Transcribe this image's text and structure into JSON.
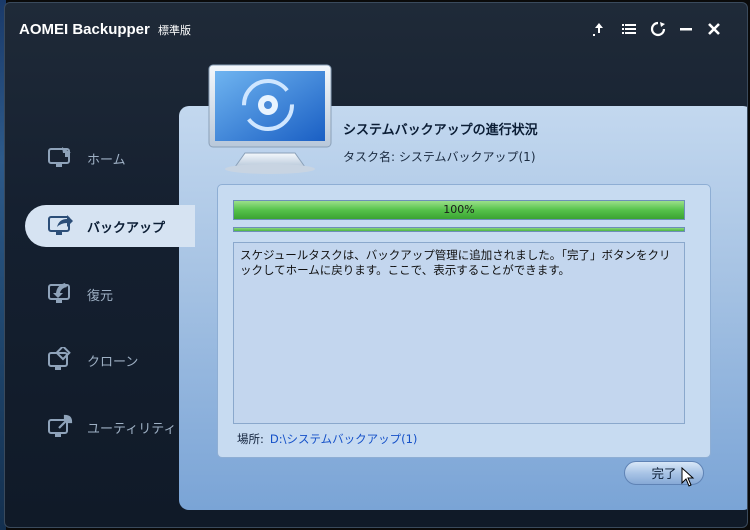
{
  "window": {
    "title": "AOMEI Backupper",
    "edition": "標準版",
    "controls": [
      "upload-icon",
      "menu-icon",
      "refresh-icon",
      "minimize-icon",
      "close-icon"
    ]
  },
  "sidebar": {
    "items": [
      {
        "label": "ホーム",
        "icon": "home-icon",
        "active": false
      },
      {
        "label": "バックアップ",
        "icon": "backup-icon",
        "active": true
      },
      {
        "label": "復元",
        "icon": "restore-icon",
        "active": false
      },
      {
        "label": "クローン",
        "icon": "clone-icon",
        "active": false
      },
      {
        "label": "ユーティリティ",
        "icon": "utility-icon",
        "active": false
      }
    ]
  },
  "main": {
    "title": "システムバックアップの進行状況",
    "task_name": "タスク名: システムバックアップ(1)",
    "progress": {
      "percent": 100,
      "text": "100%"
    },
    "message": "スケジュールタスクは、バックアップ管理に追加されました。「完了」ボタンをクリックしてホームに戻ります。ここで、表示することができます。",
    "location_label": "場所:",
    "location_path": "D:\\システムバックアップ(1)",
    "finish_button": "完了"
  },
  "colors": {
    "accent": "#1450c8",
    "progress_green": "#55c24a",
    "panel_blue": "#a8c4e4"
  }
}
